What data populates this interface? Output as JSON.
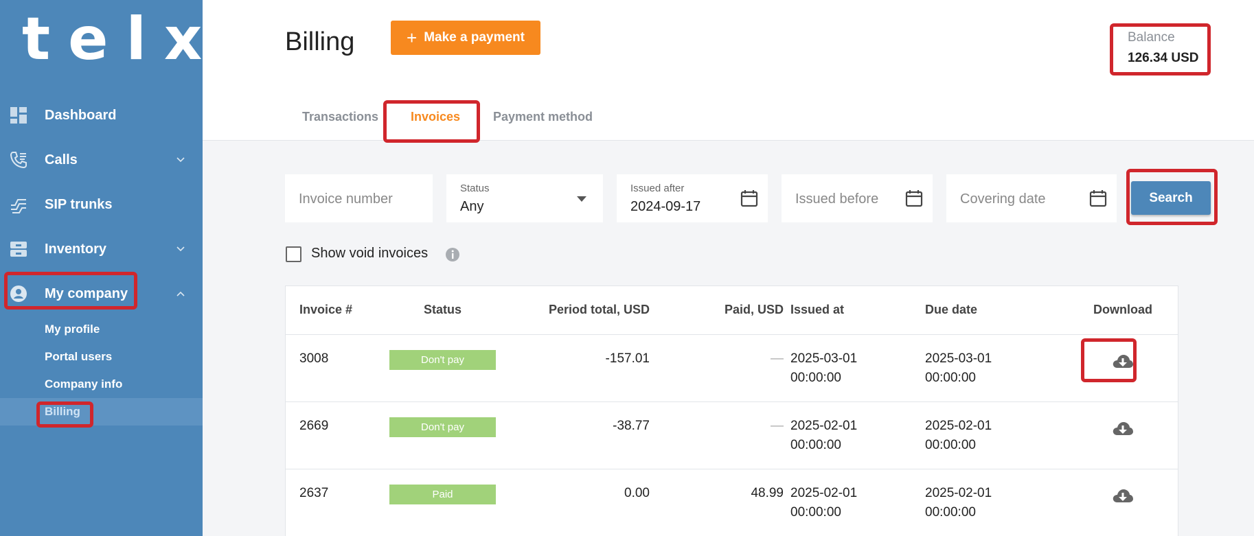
{
  "app": {
    "logo": "telxi"
  },
  "sidebar": {
    "items": [
      {
        "label": "Dashboard",
        "icon": "dashboard-icon"
      },
      {
        "label": "Calls",
        "icon": "calls-icon"
      },
      {
        "label": "SIP trunks",
        "icon": "sip-trunks-icon"
      },
      {
        "label": "Inventory",
        "icon": "inventory-icon"
      },
      {
        "label": "My company",
        "icon": "user-circle-icon"
      }
    ],
    "subitems": [
      {
        "label": "My profile"
      },
      {
        "label": "Portal users"
      },
      {
        "label": "Company info"
      },
      {
        "label": "Billing",
        "active": true
      }
    ]
  },
  "header": {
    "title": "Billing",
    "pay_button": "Make a payment",
    "pay_plus": "+",
    "balance_label": "Balance",
    "balance_value": "126.34 USD",
    "tabs": [
      {
        "label": "Transactions"
      },
      {
        "label": "Invoices",
        "active": true
      },
      {
        "label": "Payment method"
      }
    ]
  },
  "filters": {
    "invoice_number_placeholder": "Invoice number",
    "status_label": "Status",
    "status_value": "Any",
    "issued_after_label": "Issued after",
    "issued_after_value": "2024-09-17",
    "issued_before_placeholder": "Issued before",
    "covering_date_placeholder": "Covering date",
    "search_button": "Search",
    "show_void_label": "Show void invoices"
  },
  "table": {
    "headers": {
      "invoice": "Invoice #",
      "status": "Status",
      "period_total": "Period total, USD",
      "paid": "Paid, USD",
      "issued_at": "Issued at",
      "due_date": "Due date",
      "download": "Download"
    },
    "rows": [
      {
        "invoice": "3008",
        "status": "Don't pay",
        "period_total": "-157.01",
        "paid": "—",
        "issued_date": "2025-03-01",
        "issued_time": "00:00:00",
        "due_date": "2025-03-01",
        "due_time": "00:00:00"
      },
      {
        "invoice": "2669",
        "status": "Don't pay",
        "period_total": "-38.77",
        "paid": "—",
        "issued_date": "2025-02-01",
        "issued_time": "00:00:00",
        "due_date": "2025-02-01",
        "due_time": "00:00:00"
      },
      {
        "invoice": "2637",
        "status": "Paid",
        "period_total": "0.00",
        "paid": "48.99",
        "issued_date": "2025-02-01",
        "issued_time": "00:00:00",
        "due_date": "2025-02-01",
        "due_time": "00:00:00"
      }
    ]
  },
  "colors": {
    "sidebar": "#4d87b9",
    "accent": "#f7891f",
    "badge": "#a1d27a",
    "highlight": "#d0262c"
  }
}
